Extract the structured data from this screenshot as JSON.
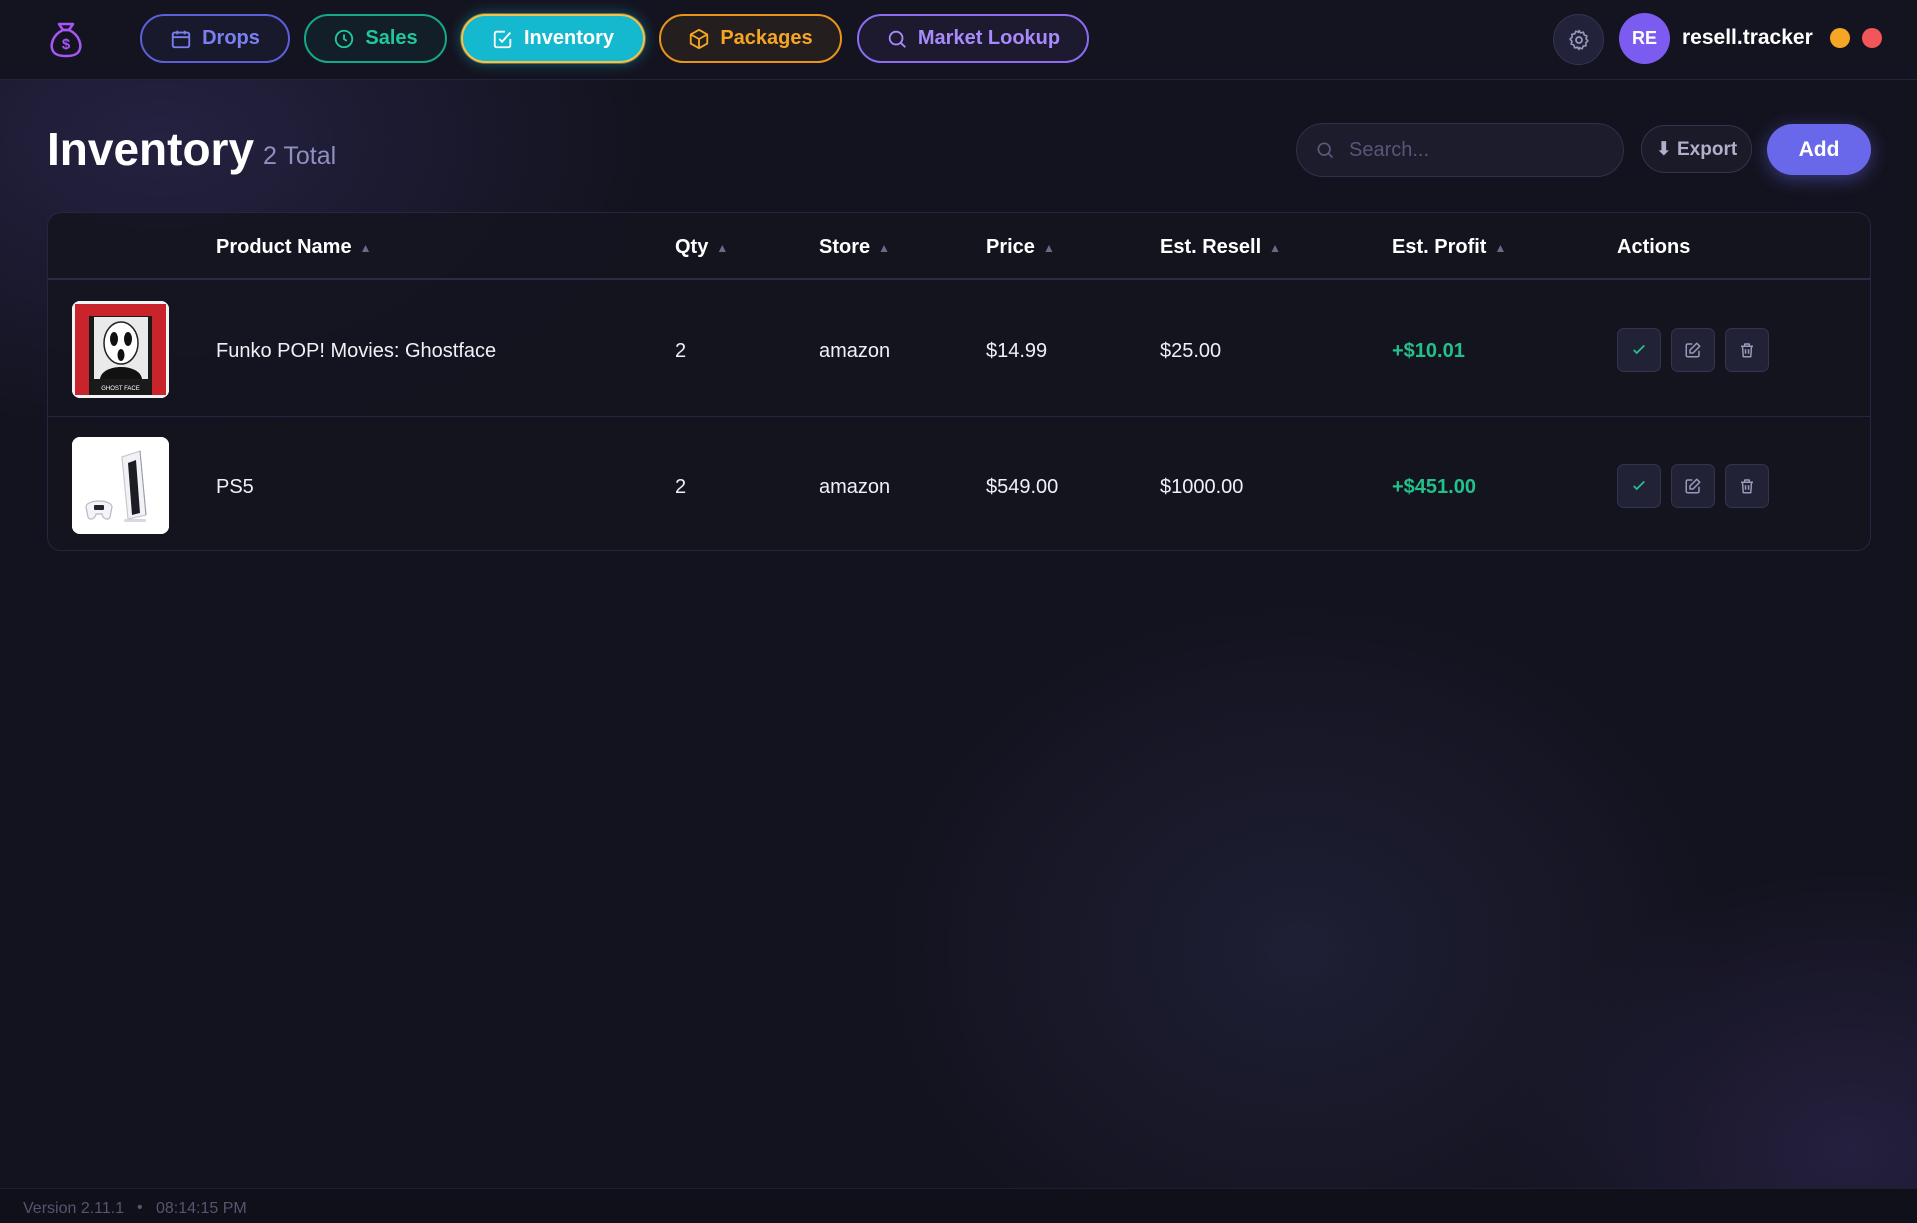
{
  "nav": {
    "drops": "Drops",
    "sales": "Sales",
    "inventory": "Inventory",
    "packages": "Packages",
    "market_lookup": "Market Lookup",
    "active": "Inventory"
  },
  "user": {
    "initials": "RE",
    "name": "resell.tracker"
  },
  "header": {
    "title": "Inventory",
    "count": "2 Total"
  },
  "search": {
    "placeholder": "Search...",
    "value": ""
  },
  "toolbar": {
    "export_label": "⬇ Export",
    "add_label": "Add"
  },
  "table": {
    "columns": [
      "Product Name",
      "Qty",
      "Store",
      "Price",
      "Est. Resell",
      "Est. Profit",
      "Actions"
    ],
    "sort_arrow": "▲",
    "rows": [
      {
        "name": "Funko POP! Movies: Ghostface",
        "qty": "2",
        "store": "amazon",
        "price": "$14.99",
        "resell": "$25.00",
        "profit": "+$10.01",
        "image": "funko-ghostface-box"
      },
      {
        "name": "PS5",
        "qty": "2",
        "store": "amazon",
        "price": "$549.00",
        "resell": "$1000.00",
        "profit": "+$451.00",
        "image": "ps5-console"
      }
    ]
  },
  "footer": {
    "version": "Version 2.11.1",
    "separator": "•",
    "time": "08:14:15 PM"
  },
  "colors": {
    "background": "#13131f",
    "accent": "#6a68ea",
    "inventory_active": "#14b8cf",
    "profit_green": "#22c08a",
    "drops": "#5b5fd8",
    "sales": "#13a98a",
    "packages": "#e8941a",
    "market": "#8c6cf0"
  }
}
